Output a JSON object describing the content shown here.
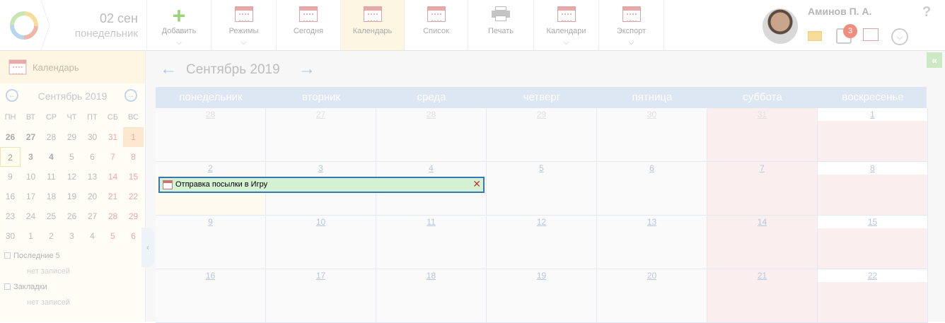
{
  "header": {
    "date": "02 сен",
    "weekday": "понедельник",
    "toolbar": [
      {
        "label": "Добавить",
        "icon": "plus-icon",
        "dropdown": true
      },
      {
        "label": "Режимы",
        "icon": "modes-calendar-icon",
        "dropdown": true
      },
      {
        "label": "Сегодня",
        "icon": "today-calendar-icon",
        "dropdown": false
      },
      {
        "label": "Календарь",
        "icon": "calendar-icon",
        "dropdown": false,
        "active": true
      },
      {
        "label": "Список",
        "icon": "list-icon",
        "dropdown": false
      },
      {
        "label": "Печать",
        "icon": "printer-icon",
        "dropdown": false
      },
      {
        "label": "Календари",
        "icon": "calendars-icon",
        "dropdown": true
      },
      {
        "label": "Экспорт",
        "icon": "export-icon",
        "dropdown": true
      }
    ],
    "user_name": "Аминов П. А.",
    "task_badge": "3",
    "help": "?"
  },
  "sidebar": {
    "title": "Календарь",
    "month": "Сентябрь 2019",
    "weekdays": [
      "ПН",
      "ВТ",
      "СР",
      "ЧТ",
      "ПТ",
      "СБ",
      "ВС"
    ],
    "weeks": [
      [
        "26",
        "27",
        "28",
        "29",
        "30",
        "31",
        "1"
      ],
      [
        "2",
        "3",
        "4",
        "5",
        "6",
        "7",
        "8"
      ],
      [
        "9",
        "10",
        "11",
        "12",
        "13",
        "14",
        "15"
      ],
      [
        "16",
        "17",
        "18",
        "19",
        "20",
        "21",
        "22"
      ],
      [
        "23",
        "24",
        "25",
        "26",
        "27",
        "28",
        "29"
      ],
      [
        "30",
        "1",
        "2",
        "3",
        "4",
        "5",
        "6"
      ]
    ],
    "tree": [
      {
        "label": "Последние 5",
        "child": "нет записей"
      },
      {
        "label": "Закладки",
        "child": "нет записей"
      }
    ]
  },
  "calendar": {
    "month_title": "Сентябрь 2019",
    "day_names": [
      "понедельник",
      "вторник",
      "среда",
      "четверг",
      "пятница",
      "суббота",
      "воскресенье"
    ],
    "weeks": [
      [
        "28",
        "27",
        "28",
        "29",
        "30",
        "31",
        "1"
      ],
      [
        "2",
        "3",
        "4",
        "5",
        "6",
        "7",
        "8"
      ],
      [
        "9",
        "10",
        "11",
        "12",
        "13",
        "14",
        "15"
      ],
      [
        "16",
        "17",
        "18",
        "19",
        "20",
        "21",
        "22"
      ]
    ],
    "event": {
      "title": "Отправка посылки в Игру",
      "close": "✕"
    }
  },
  "colors": {
    "accent_blue": "#a8c4e6",
    "weekend": "#fbeeee",
    "event_bg": "#d4f1d4",
    "event_border": "#3877b4"
  }
}
